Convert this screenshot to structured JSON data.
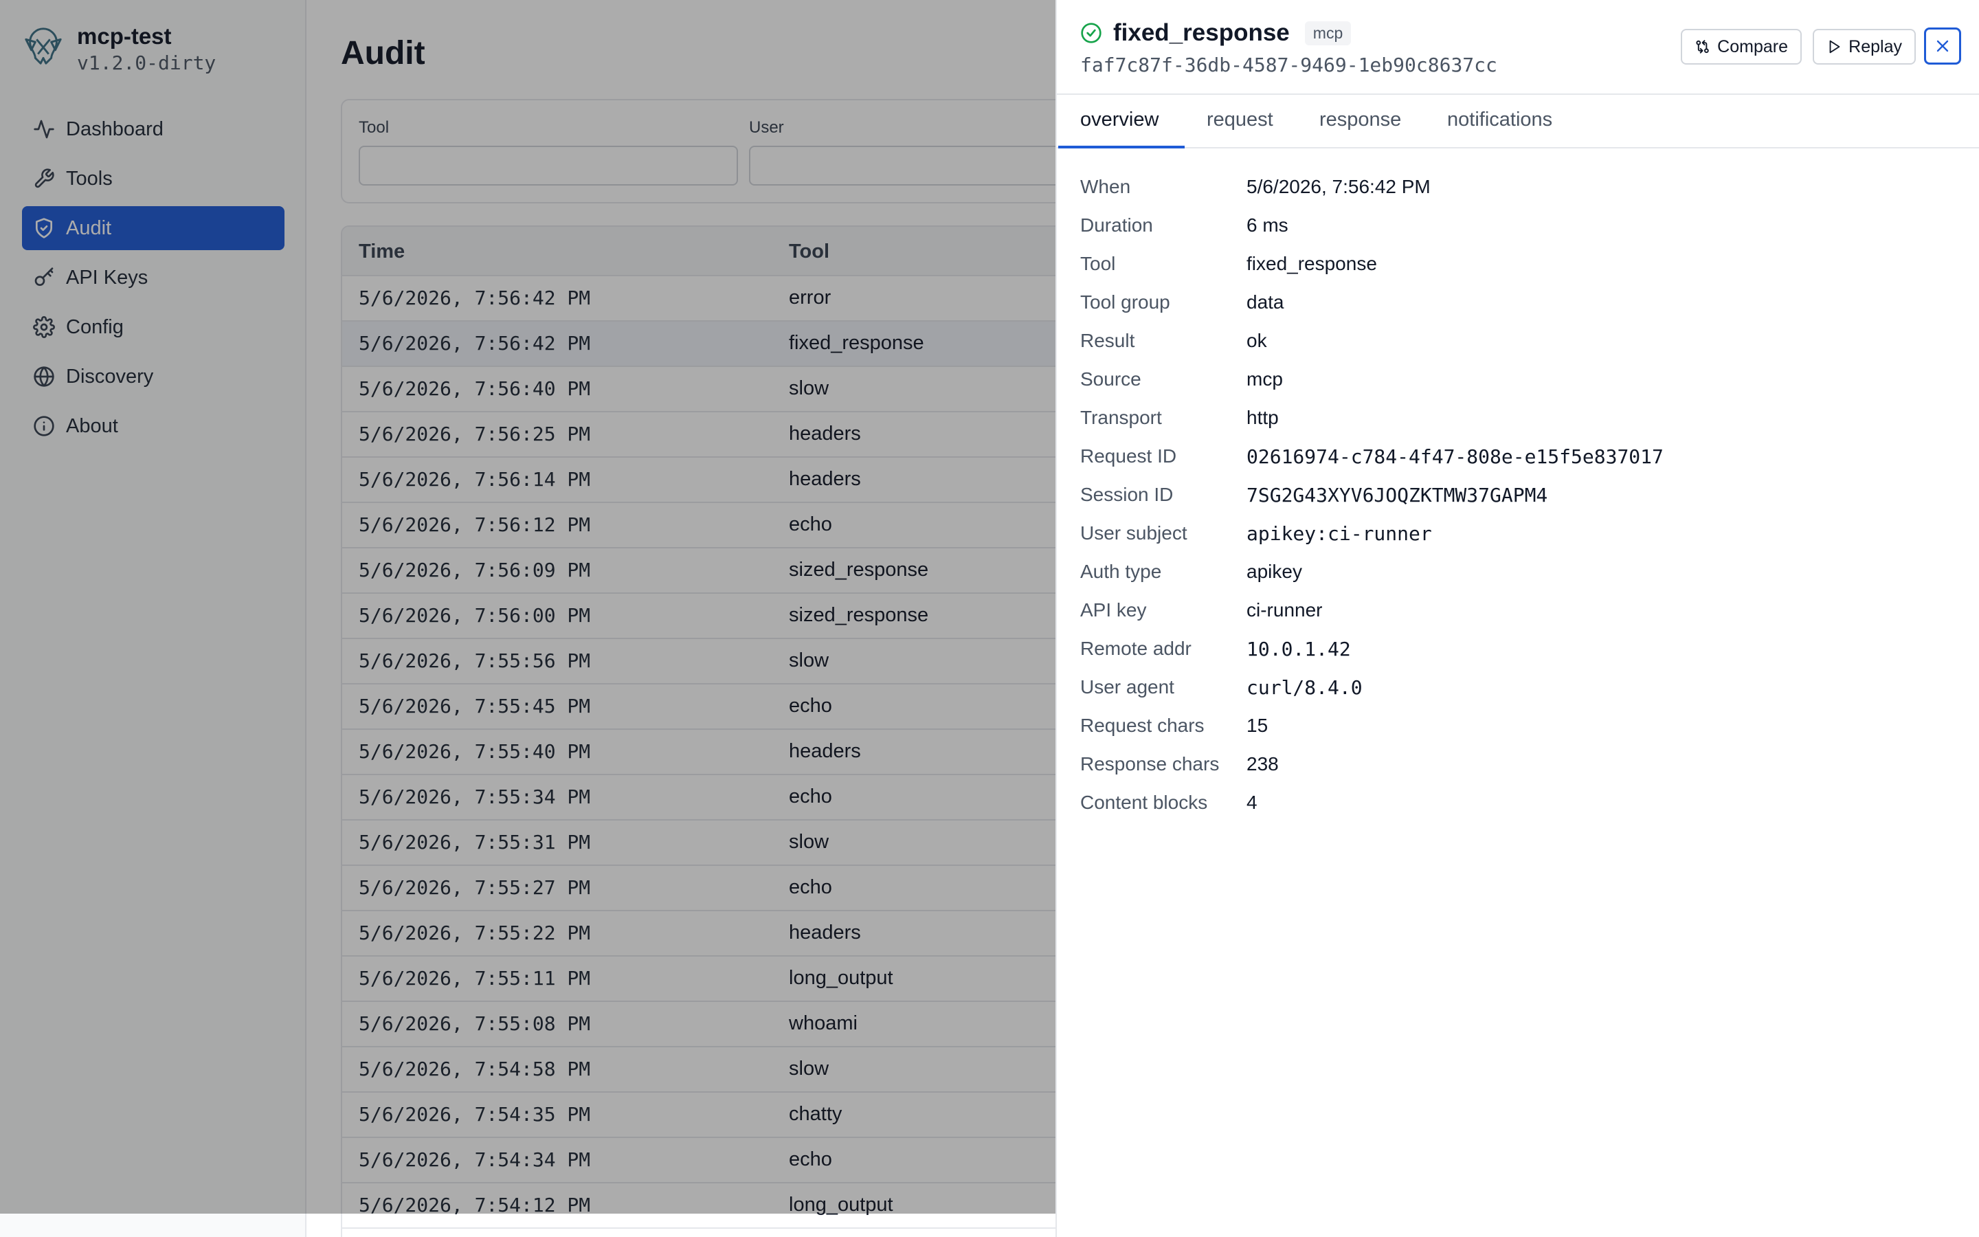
{
  "app": {
    "name": "mcp-test",
    "version": "v1.2.0-dirty"
  },
  "nav": [
    {
      "label": "Dashboard",
      "icon": "activity-icon",
      "active": false
    },
    {
      "label": "Tools",
      "icon": "wrench-icon",
      "active": false
    },
    {
      "label": "Audit",
      "icon": "shield-check-icon",
      "active": true
    },
    {
      "label": "API Keys",
      "icon": "key-icon",
      "active": false
    },
    {
      "label": "Config",
      "icon": "gear-icon",
      "active": false
    },
    {
      "label": "Discovery",
      "icon": "globe-icon",
      "active": false
    },
    {
      "label": "About",
      "icon": "info-icon",
      "active": false
    }
  ],
  "page": {
    "title": "Audit"
  },
  "filters": {
    "tool": {
      "label": "Tool",
      "value": ""
    },
    "user": {
      "label": "User",
      "value": ""
    }
  },
  "table": {
    "columns": [
      "Time",
      "Tool"
    ],
    "rows": [
      {
        "time": "5/6/2026, 7:56:42 PM",
        "tool": "error"
      },
      {
        "time": "5/6/2026, 7:56:42 PM",
        "tool": "fixed_response"
      },
      {
        "time": "5/6/2026, 7:56:40 PM",
        "tool": "slow"
      },
      {
        "time": "5/6/2026, 7:56:25 PM",
        "tool": "headers"
      },
      {
        "time": "5/6/2026, 7:56:14 PM",
        "tool": "headers"
      },
      {
        "time": "5/6/2026, 7:56:12 PM",
        "tool": "echo"
      },
      {
        "time": "5/6/2026, 7:56:09 PM",
        "tool": "sized_response"
      },
      {
        "time": "5/6/2026, 7:56:00 PM",
        "tool": "sized_response"
      },
      {
        "time": "5/6/2026, 7:55:56 PM",
        "tool": "slow"
      },
      {
        "time": "5/6/2026, 7:55:45 PM",
        "tool": "echo"
      },
      {
        "time": "5/6/2026, 7:55:40 PM",
        "tool": "headers"
      },
      {
        "time": "5/6/2026, 7:55:34 PM",
        "tool": "echo"
      },
      {
        "time": "5/6/2026, 7:55:31 PM",
        "tool": "slow"
      },
      {
        "time": "5/6/2026, 7:55:27 PM",
        "tool": "echo"
      },
      {
        "time": "5/6/2026, 7:55:22 PM",
        "tool": "headers"
      },
      {
        "time": "5/6/2026, 7:55:11 PM",
        "tool": "long_output"
      },
      {
        "time": "5/6/2026, 7:55:08 PM",
        "tool": "whoami"
      },
      {
        "time": "5/6/2026, 7:54:58 PM",
        "tool": "slow"
      },
      {
        "time": "5/6/2026, 7:54:35 PM",
        "tool": "chatty"
      },
      {
        "time": "5/6/2026, 7:54:34 PM",
        "tool": "echo"
      },
      {
        "time": "5/6/2026, 7:54:12 PM",
        "tool": "long_output"
      }
    ]
  },
  "drawer": {
    "title": "fixed_response",
    "source_badge": "mcp",
    "id": "faf7c87f-36db-4587-9469-1eb90c8637cc",
    "status_icon": "check-circle-icon",
    "buttons": {
      "compare": "Compare",
      "replay": "Replay"
    },
    "tabs": [
      {
        "label": "overview",
        "active": true
      },
      {
        "label": "request",
        "active": false
      },
      {
        "label": "response",
        "active": false
      },
      {
        "label": "notifications",
        "active": false
      }
    ],
    "details": [
      {
        "label": "When",
        "value": "5/6/2026, 7:56:42 PM",
        "mono": false
      },
      {
        "label": "Duration",
        "value": "6 ms",
        "mono": false
      },
      {
        "label": "Tool",
        "value": "fixed_response",
        "mono": false
      },
      {
        "label": "Tool group",
        "value": "data",
        "mono": false
      },
      {
        "label": "Result",
        "value": "ok",
        "mono": false
      },
      {
        "label": "Source",
        "value": "mcp",
        "mono": false
      },
      {
        "label": "Transport",
        "value": "http",
        "mono": false
      },
      {
        "label": "Request ID",
        "value": "02616974-c784-4f47-808e-e15f5e837017",
        "mono": true
      },
      {
        "label": "Session ID",
        "value": "7SG2G43XYV6JOQZKTMW37GAPM4",
        "mono": true
      },
      {
        "label": "User subject",
        "value": "apikey:ci-runner",
        "mono": true
      },
      {
        "label": "Auth type",
        "value": "apikey",
        "mono": false
      },
      {
        "label": "API key",
        "value": "ci-runner",
        "mono": false
      },
      {
        "label": "Remote addr",
        "value": "10.0.1.42",
        "mono": true
      },
      {
        "label": "User agent",
        "value": "curl/8.4.0",
        "mono": true
      },
      {
        "label": "Request chars",
        "value": "15",
        "mono": false
      },
      {
        "label": "Response chars",
        "value": "238",
        "mono": false
      },
      {
        "label": "Content blocks",
        "value": "4",
        "mono": false
      }
    ]
  },
  "colors": {
    "accent": "#1f5bd6",
    "success": "#16a34a",
    "overlay": "rgba(17,17,17,0.35)"
  }
}
